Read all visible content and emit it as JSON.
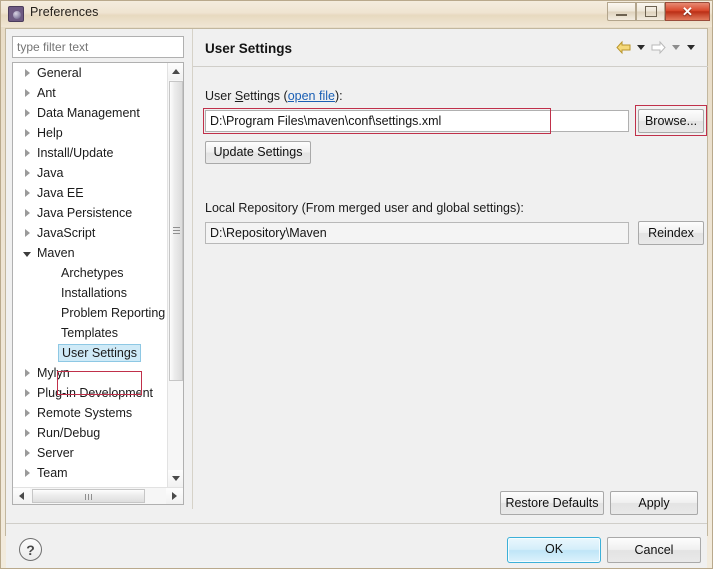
{
  "window": {
    "title": "Preferences",
    "app_icon": "preferences-gear-icon",
    "controls": {
      "minimize": "minimize-icon",
      "restore": "restore-icon",
      "close": "✕"
    }
  },
  "sidebar": {
    "filter": {
      "value": "",
      "placeholder": "type filter text"
    },
    "items": [
      {
        "label": "General",
        "level": 0,
        "state": "collapsed",
        "selected": false
      },
      {
        "label": "Ant",
        "level": 0,
        "state": "collapsed",
        "selected": false
      },
      {
        "label": "Data Management",
        "level": 0,
        "state": "collapsed",
        "selected": false
      },
      {
        "label": "Help",
        "level": 0,
        "state": "collapsed",
        "selected": false
      },
      {
        "label": "Install/Update",
        "level": 0,
        "state": "collapsed",
        "selected": false
      },
      {
        "label": "Java",
        "level": 0,
        "state": "collapsed",
        "selected": false
      },
      {
        "label": "Java EE",
        "level": 0,
        "state": "collapsed",
        "selected": false
      },
      {
        "label": "Java Persistence",
        "level": 0,
        "state": "collapsed",
        "selected": false
      },
      {
        "label": "JavaScript",
        "level": 0,
        "state": "collapsed",
        "selected": false
      },
      {
        "label": "Maven",
        "level": 0,
        "state": "expanded",
        "selected": false
      },
      {
        "label": "Archetypes",
        "level": 1,
        "state": "leaf",
        "selected": false
      },
      {
        "label": "Installations",
        "level": 1,
        "state": "leaf",
        "selected": false
      },
      {
        "label": "Problem Reporting",
        "level": 1,
        "state": "leaf",
        "selected": false
      },
      {
        "label": "Templates",
        "level": 1,
        "state": "leaf",
        "selected": false
      },
      {
        "label": "User Settings",
        "level": 1,
        "state": "leaf",
        "selected": true
      },
      {
        "label": "Mylyn",
        "level": 0,
        "state": "collapsed",
        "selected": false
      },
      {
        "label": "Plug-in Development",
        "level": 0,
        "state": "collapsed",
        "selected": false
      },
      {
        "label": "Remote Systems",
        "level": 0,
        "state": "collapsed",
        "selected": false
      },
      {
        "label": "Run/Debug",
        "level": 0,
        "state": "collapsed",
        "selected": false
      },
      {
        "label": "Server",
        "level": 0,
        "state": "collapsed",
        "selected": false
      },
      {
        "label": "Team",
        "level": 0,
        "state": "collapsed",
        "selected": false
      }
    ],
    "scrollbars": {
      "vertical": "vertical-scrollbar",
      "horizontal": "horizontal-scrollbar"
    }
  },
  "page": {
    "heading": "User Settings",
    "nav": {
      "back": "back-arrow-icon",
      "back_menu": "chevron-down-icon",
      "forward": "forward-arrow-icon",
      "forward_menu": "chevron-down-icon",
      "view_menu": "chevron-down-icon"
    },
    "user_settings": {
      "label_prefix": "User ",
      "label_mnemonic": "S",
      "label_rest": "ettings (",
      "link": "open file",
      "label_suffix": "):",
      "value": "D:\\Program Files\\maven\\conf\\settings.xml",
      "browse_label": "Browse...",
      "update_label": "Update Settings"
    },
    "local_repository": {
      "label": "Local Repository (From merged user and global settings):",
      "value": "D:\\Repository\\Maven",
      "reindex_label": "Reindex"
    },
    "restore_defaults_label": "Restore Defaults",
    "apply_label": "Apply"
  },
  "footer": {
    "help_icon": "?",
    "ok_label": "OK",
    "cancel_label": "Cancel"
  },
  "annotations": {
    "color": "#c0304a",
    "boxes": [
      "user-settings-input",
      "browse-button",
      "tree-user-settings"
    ]
  }
}
